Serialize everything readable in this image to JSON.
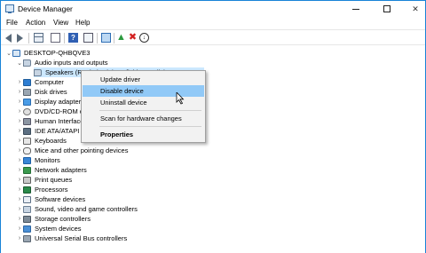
{
  "window": {
    "title": "Device Manager"
  },
  "menubar": {
    "items": [
      "File",
      "Action",
      "View",
      "Help"
    ]
  },
  "tree": {
    "root": "DESKTOP-QHBQVE3",
    "expanded_category": "Audio inputs and outputs",
    "child_device": "Speakers (Realtek High Definition Audio)",
    "categories": [
      "Computer",
      "Disk drives",
      "Display adapters",
      "DVD/CD-ROM drives",
      "Human Interface Devices",
      "IDE ATA/ATAPI controllers",
      "Keyboards",
      "Mice and other pointing devices",
      "Monitors",
      "Network adapters",
      "Print queues",
      "Processors",
      "Software devices",
      "Sound, video and game controllers",
      "Storage controllers",
      "System devices",
      "Universal Serial Bus controllers"
    ]
  },
  "context_menu": {
    "update": "Update driver",
    "disable": "Disable device",
    "uninstall": "Uninstall device",
    "scan": "Scan for hardware changes",
    "properties": "Properties"
  },
  "colors": {
    "accent": "#1883d7",
    "selection": "#cce8ff",
    "menu_hover": "#91c9f7"
  }
}
